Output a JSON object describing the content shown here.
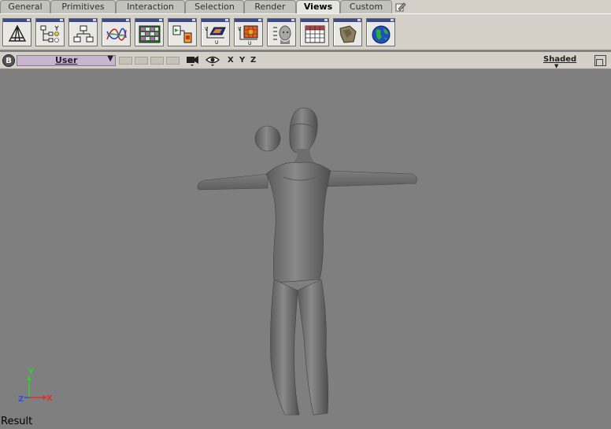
{
  "tabs": [
    {
      "label": "General",
      "active": false
    },
    {
      "label": "Primitives",
      "active": false
    },
    {
      "label": "Interaction",
      "active": false
    },
    {
      "label": "Selection",
      "active": false
    },
    {
      "label": "Render",
      "active": false
    },
    {
      "label": "Views",
      "active": true
    },
    {
      "label": "Custom",
      "active": false
    }
  ],
  "toolbar_tools": [
    "perspective-pyramid-icon",
    "schematic-hierarchy-icon",
    "flowchart-icon",
    "animation-curve-icon",
    "dopesheet-icon",
    "render-tree-icon",
    "texture-layer-icon",
    "uv-editor-icon",
    "head-profile-icon",
    "spreadsheet-icon",
    "material-icon",
    "globe-icon"
  ],
  "viewport": {
    "badge": "B",
    "view_name": "User",
    "axes": [
      "X",
      "Y",
      "Z"
    ],
    "shading": "Shaded",
    "status": "Result",
    "gizmo": {
      "y": "Y",
      "x": "X",
      "z": "Z"
    }
  },
  "colors": {
    "viewport_bg": "#7f7f7f",
    "panel_bg": "#d4d0c8",
    "view_select_bg": "#c8b6cc",
    "axis_x": "#e03030",
    "axis_y": "#30d030",
    "axis_z": "#3050e0"
  }
}
